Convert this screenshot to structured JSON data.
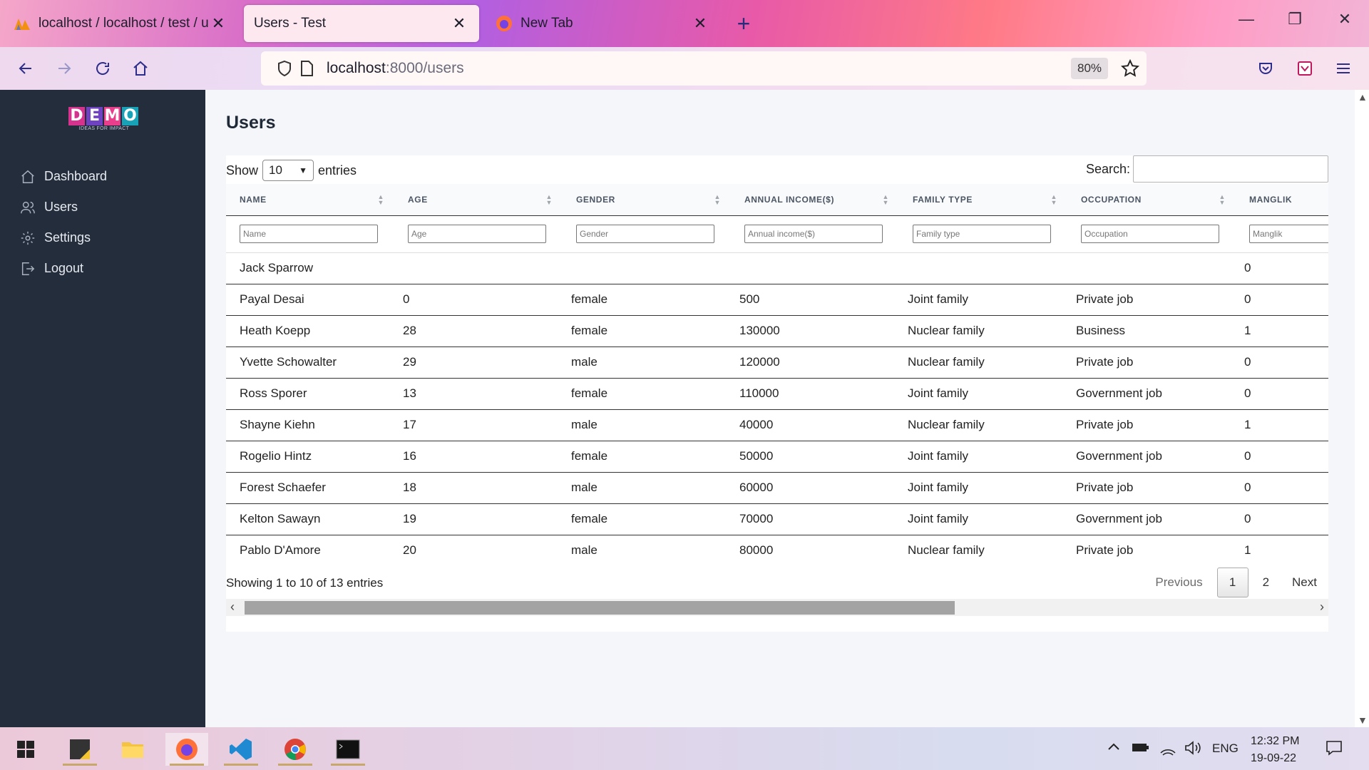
{
  "browser": {
    "tabs": [
      {
        "title": "localhost / localhost / test / users"
      },
      {
        "title": "Users - Test"
      },
      {
        "title": "New Tab"
      }
    ],
    "url_host": "localhost",
    "url_rest": ":8000/users",
    "zoom": "80%"
  },
  "sidebar": {
    "logo_letters": [
      "D",
      "E",
      "M",
      "O"
    ],
    "logo_colors": [
      "#d6338f",
      "#6f42c1",
      "#e83e8c",
      "#17a2b8"
    ],
    "logo_tagline": "IDEAS FOR IMPACT",
    "items": [
      {
        "label": "Dashboard",
        "icon": "home-icon"
      },
      {
        "label": "Users",
        "icon": "users-icon"
      },
      {
        "label": "Settings",
        "icon": "gear-icon"
      },
      {
        "label": "Logout",
        "icon": "logout-icon"
      }
    ]
  },
  "page": {
    "title": "Users"
  },
  "datatable": {
    "show_label": "Show",
    "entries_label": "entries",
    "page_length": "10",
    "search_label": "Search:",
    "columns": [
      "NAME",
      "AGE",
      "GENDER",
      "ANNUAL INCOME($)",
      "FAMILY TYPE",
      "OCCUPATION",
      "MANGLIK"
    ],
    "filter_placeholders": [
      "Name",
      "Age",
      "Gender",
      "Annual income($)",
      "Family type",
      "Occupation",
      "Manglik"
    ],
    "rows": [
      [
        "Jack Sparrow",
        "",
        "",
        "",
        "",
        "",
        "0"
      ],
      [
        "Payal Desai",
        "0",
        "female",
        "500",
        "Joint family",
        "Private job",
        "0"
      ],
      [
        "Heath Koepp",
        "28",
        "female",
        "130000",
        "Nuclear family",
        "Business",
        "1"
      ],
      [
        "Yvette Schowalter",
        "29",
        "male",
        "120000",
        "Nuclear family",
        "Private job",
        "0"
      ],
      [
        "Ross Sporer",
        "13",
        "female",
        "110000",
        "Joint family",
        "Government job",
        "0"
      ],
      [
        "Shayne Kiehn",
        "17",
        "male",
        "40000",
        "Nuclear family",
        "Private job",
        "1"
      ],
      [
        "Rogelio Hintz",
        "16",
        "female",
        "50000",
        "Joint family",
        "Government job",
        "0"
      ],
      [
        "Forest Schaefer",
        "18",
        "male",
        "60000",
        "Joint family",
        "Private job",
        "0"
      ],
      [
        "Kelton Sawayn",
        "19",
        "female",
        "70000",
        "Joint family",
        "Government job",
        "0"
      ],
      [
        "Pablo D'Amore",
        "20",
        "male",
        "80000",
        "Nuclear family",
        "Private job",
        "1"
      ]
    ],
    "info": "Showing 1 to 10 of 13 entries",
    "pagination": {
      "previous": "Previous",
      "pages": [
        "1",
        "2"
      ],
      "current": "1",
      "next": "Next"
    }
  },
  "taskbar": {
    "language": "ENG",
    "time": "12:32 PM",
    "date": "19-09-22"
  }
}
